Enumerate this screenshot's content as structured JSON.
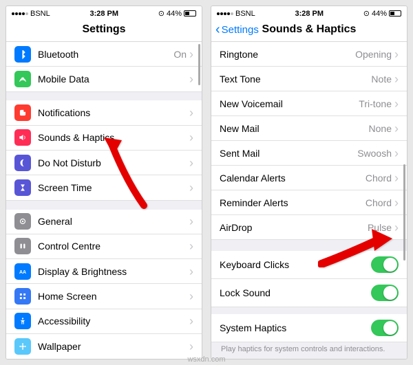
{
  "left": {
    "statusbar": {
      "carrier": "BSNL",
      "time": "3:28 PM",
      "battery": "44%"
    },
    "title": "Settings",
    "group1": [
      {
        "label": "Bluetooth",
        "value": "On"
      },
      {
        "label": "Mobile Data",
        "value": ""
      }
    ],
    "group2": [
      {
        "label": "Notifications"
      },
      {
        "label": "Sounds & Haptics"
      },
      {
        "label": "Do Not Disturb"
      },
      {
        "label": "Screen Time"
      }
    ],
    "group3": [
      {
        "label": "General"
      },
      {
        "label": "Control Centre"
      },
      {
        "label": "Display & Brightness"
      },
      {
        "label": "Home Screen"
      },
      {
        "label": "Accessibility"
      },
      {
        "label": "Wallpaper"
      }
    ]
  },
  "right": {
    "statusbar": {
      "carrier": "BSNL",
      "time": "3:28 PM",
      "battery": "44%"
    },
    "back": "Settings",
    "title": "Sounds & Haptics",
    "sounds": [
      {
        "label": "Ringtone",
        "value": "Opening"
      },
      {
        "label": "Text Tone",
        "value": "Note"
      },
      {
        "label": "New Voicemail",
        "value": "Tri-tone"
      },
      {
        "label": "New Mail",
        "value": "None"
      },
      {
        "label": "Sent Mail",
        "value": "Swoosh"
      },
      {
        "label": "Calendar Alerts",
        "value": "Chord"
      },
      {
        "label": "Reminder Alerts",
        "value": "Chord"
      },
      {
        "label": "AirDrop",
        "value": "Pulse"
      }
    ],
    "toggles": [
      {
        "label": "Keyboard Clicks"
      },
      {
        "label": "Lock Sound"
      }
    ],
    "system": {
      "label": "System Haptics"
    },
    "footer": "Play haptics for system controls and interactions."
  },
  "watermark": "wsxdn.com"
}
